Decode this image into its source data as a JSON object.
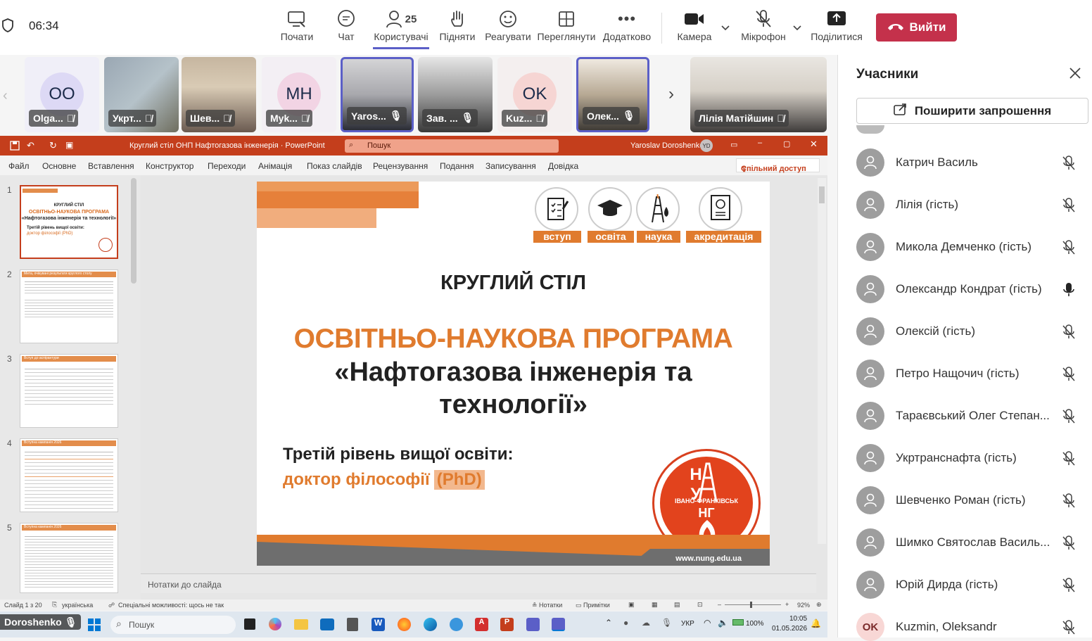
{
  "status": {
    "time": "06:34"
  },
  "toolbar": {
    "items": [
      {
        "label": "Почати"
      },
      {
        "label": "Чат"
      },
      {
        "label": "Користувачі",
        "count": "25"
      },
      {
        "label": "Підняти"
      },
      {
        "label": "Реагувати"
      },
      {
        "label": "Переглянути"
      },
      {
        "label": "Додатково"
      },
      {
        "label": "Камера"
      },
      {
        "label": "Мікрофон"
      },
      {
        "label": "Поділитися"
      }
    ],
    "leave_label": "Вийти",
    "accent": "#5b5fc7",
    "leave_color": "#c4314b"
  },
  "videos": [
    {
      "name": "Olga...",
      "initials": "OO",
      "avatar_color": "#e3e0f5"
    },
    {
      "name": "Укрт..."
    },
    {
      "name": "Шев..."
    },
    {
      "name": "Myk...",
      "initials": "MH",
      "avatar_color": "#f4d6e6"
    },
    {
      "name": "Yaros..."
    },
    {
      "name": "Зав. ..."
    },
    {
      "name": "Kuz...",
      "initials": "OK",
      "avatar_color": "#f8d7d5"
    },
    {
      "name": "Олек..."
    },
    {
      "name": "Лілія Матійшин"
    }
  ],
  "panel": {
    "title": "Учасники",
    "invite_label": "Поширити запрошення",
    "participants": [
      {
        "name": "Катрич Василь",
        "mic": "muted"
      },
      {
        "name": "Лілія (гість)",
        "mic": "muted"
      },
      {
        "name": "Микола Демченко (гість)",
        "mic": "muted"
      },
      {
        "name": "Олександр Кондрат (гість)",
        "mic": "on"
      },
      {
        "name": "Олексій (гість)",
        "mic": "muted"
      },
      {
        "name": "Петро Нащочич (гість)",
        "mic": "muted"
      },
      {
        "name": "Тараєвський Олег Степан...",
        "mic": "muted"
      },
      {
        "name": "Укртранснафта (гість)",
        "mic": "muted"
      },
      {
        "name": "Шевченко Роман (гість)",
        "mic": "muted"
      },
      {
        "name": "Шимко Святослав Василь...",
        "mic": "muted"
      },
      {
        "name": "Юрій Дирда (гість)",
        "mic": "muted"
      },
      {
        "name": "Kuzmin, Oleksandr",
        "mic": "muted",
        "initials": "OK"
      }
    ]
  },
  "ppt": {
    "title": "Круглий стіл ОНП Нафтогазова інженерія · PowerPoint",
    "search": "Пошук",
    "user": "Yaroslav Doroshenko",
    "user_initials": "YD",
    "menu": [
      "Файл",
      "Основне",
      "Вставлення",
      "Конструктор",
      "Переходи",
      "Анімація",
      "Показ слайдів",
      "Рецензування",
      "Подання",
      "Записування",
      "Довідка"
    ],
    "share": "Спільний доступ",
    "notes_placeholder": "Нотатки до слайда",
    "status_left": "Слайд 1 з 20",
    "status_lang": "українська",
    "status_access": "Спеціальні можливості: щось не так",
    "status_notes": "Нотатки",
    "status_comments": "Примітки",
    "zoom": "92%",
    "thumb_numbers": [
      "1",
      "2",
      "3",
      "4",
      "5"
    ],
    "thumb1": {
      "l1": "КРУГЛИЙ СТІЛ",
      "l2": "ОСВІТНЬО-НАУКОВА ПРОГРАМА",
      "l3": "«Нафтогазова інженерія та технології»",
      "l4": "Третій рівень вищої освіти:",
      "l5": "доктор філософії (PhD)"
    },
    "thumb_titles": [
      "Мета, очікувані результати круглого столу",
      "Вступ до аспірантури",
      "Вступна кампанія 2026",
      "Вступна кампанія 2026"
    ]
  },
  "slide": {
    "icons": [
      "вступ",
      "освіта",
      "наука",
      "акредитація"
    ],
    "line1": "КРУГЛИЙ СТІЛ",
    "line2": "ОСВІТНЬО-НАУКОВА ПРОГРАМА",
    "line3": "«Нафтогазова інженерія та",
    "line4": "технології»",
    "line5": "Третій рівень вищої освіти:",
    "line6": "доктор філософії",
    "line6b": "(PhD)",
    "logo_top": "Н  У",
    "logo_mid": "ІВАНО-ФРАНКІВСЬК",
    "logo_bottom": "НГ",
    "url": "www.nung.edu.ua",
    "orange": "#e07b2e"
  },
  "taskbar": {
    "presenter": "Doroshenko",
    "search": "Пошук",
    "lang": "УКР",
    "battery": "100%",
    "clock_time": "10:05",
    "clock_date": "01.05.2026"
  }
}
